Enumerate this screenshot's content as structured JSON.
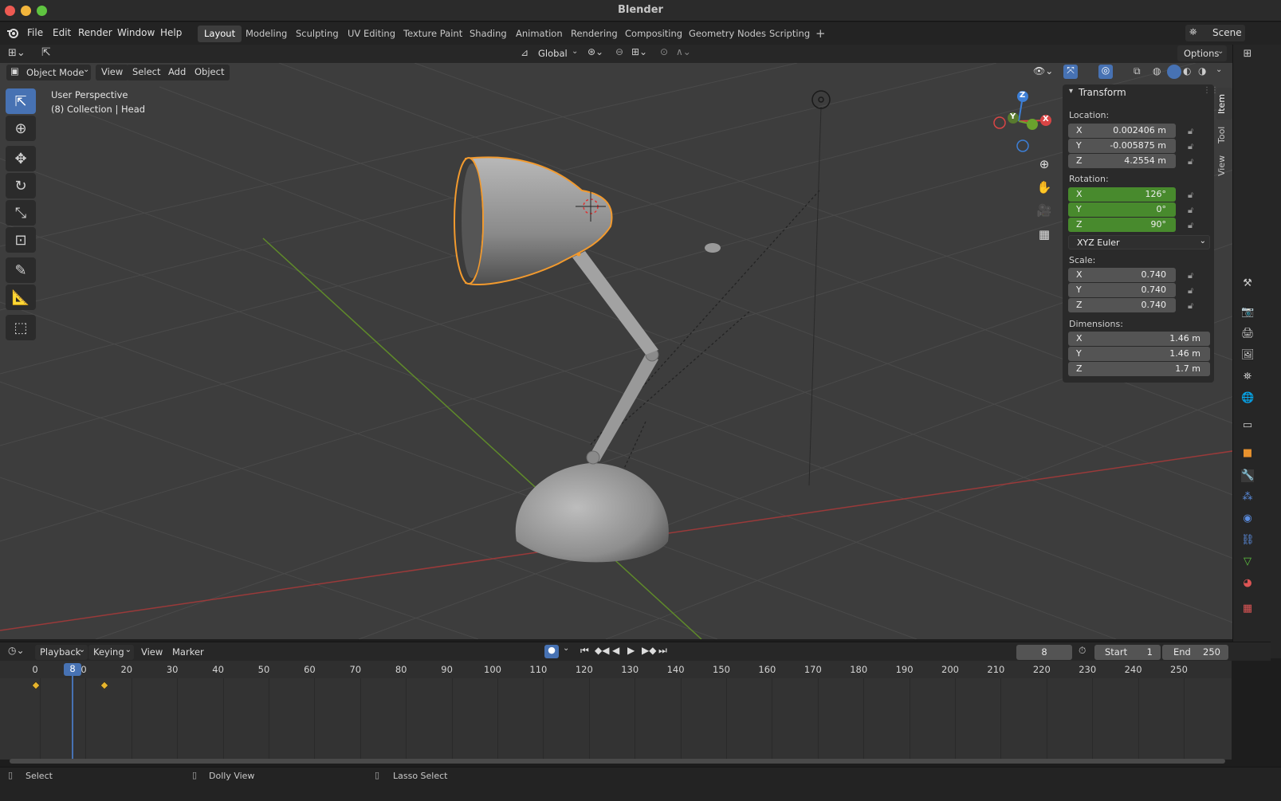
{
  "window": {
    "title": "Blender"
  },
  "menu": [
    "File",
    "Edit",
    "Render",
    "Window",
    "Help"
  ],
  "workspaces": [
    {
      "label": "Layout",
      "active": true
    },
    {
      "label": "Modeling",
      "active": false
    },
    {
      "label": "Sculpting",
      "active": false
    },
    {
      "label": "UV Editing",
      "active": false
    },
    {
      "label": "Texture Paint",
      "active": false
    },
    {
      "label": "Shading",
      "active": false
    },
    {
      "label": "Animation",
      "active": false
    },
    {
      "label": "Rendering",
      "active": false
    },
    {
      "label": "Compositing",
      "active": false
    },
    {
      "label": "Geometry Nodes",
      "active": false
    },
    {
      "label": "Scripting",
      "active": false
    }
  ],
  "scene_label": "Scene",
  "header": {
    "transform_orientation": "Global",
    "options_label": "Options"
  },
  "viewport_header": {
    "mode": "Object Mode",
    "view": "View",
    "select": "Select",
    "add": "Add",
    "object": "Object"
  },
  "viewport": {
    "perspective": "User Perspective",
    "collection": "(8) Collection | Head"
  },
  "gizmo": {
    "x": "X",
    "y": "Y",
    "z": "Z"
  },
  "npanel": {
    "title": "Transform",
    "location_label": "Location:",
    "location": [
      {
        "axis": "X",
        "value": "0.002406 m"
      },
      {
        "axis": "Y",
        "value": "-0.005875 m"
      },
      {
        "axis": "Z",
        "value": "4.2554 m"
      }
    ],
    "rotation_label": "Rotation:",
    "rotation": [
      {
        "axis": "X",
        "value": "126°"
      },
      {
        "axis": "Y",
        "value": "0°"
      },
      {
        "axis": "Z",
        "value": "90°"
      }
    ],
    "rotation_mode": "XYZ Euler",
    "scale_label": "Scale:",
    "scale": [
      {
        "axis": "X",
        "value": "0.740"
      },
      {
        "axis": "Y",
        "value": "0.740"
      },
      {
        "axis": "Z",
        "value": "0.740"
      }
    ],
    "dimensions_label": "Dimensions:",
    "dimensions": [
      {
        "axis": "X",
        "value": "1.46 m"
      },
      {
        "axis": "Y",
        "value": "1.46 m"
      },
      {
        "axis": "Z",
        "value": "1.7 m"
      }
    ]
  },
  "side_tabs": [
    "Item",
    "Tool",
    "View"
  ],
  "timeline": {
    "playback": "Playback",
    "keying": "Keying",
    "view": "View",
    "marker": "Marker",
    "current_frame": "8",
    "start_label": "Start",
    "start": "1",
    "end_label": "End",
    "end": "250",
    "ticks": [
      "0",
      "10",
      "20",
      "30",
      "40",
      "50",
      "60",
      "70",
      "80",
      "90",
      "100",
      "110",
      "120",
      "130",
      "140",
      "150",
      "160",
      "170",
      "180",
      "190",
      "200",
      "210",
      "220",
      "230",
      "240",
      "250"
    ],
    "playhead_label": "8"
  },
  "status": {
    "select": "Select",
    "dolly": "Dolly View",
    "lasso": "Lasso Select"
  },
  "colors": {
    "accent": "#4772b3",
    "selection_outline": "#f29a2e",
    "rotation_field": "#488a2d",
    "keyframe": "#e8b52c"
  }
}
